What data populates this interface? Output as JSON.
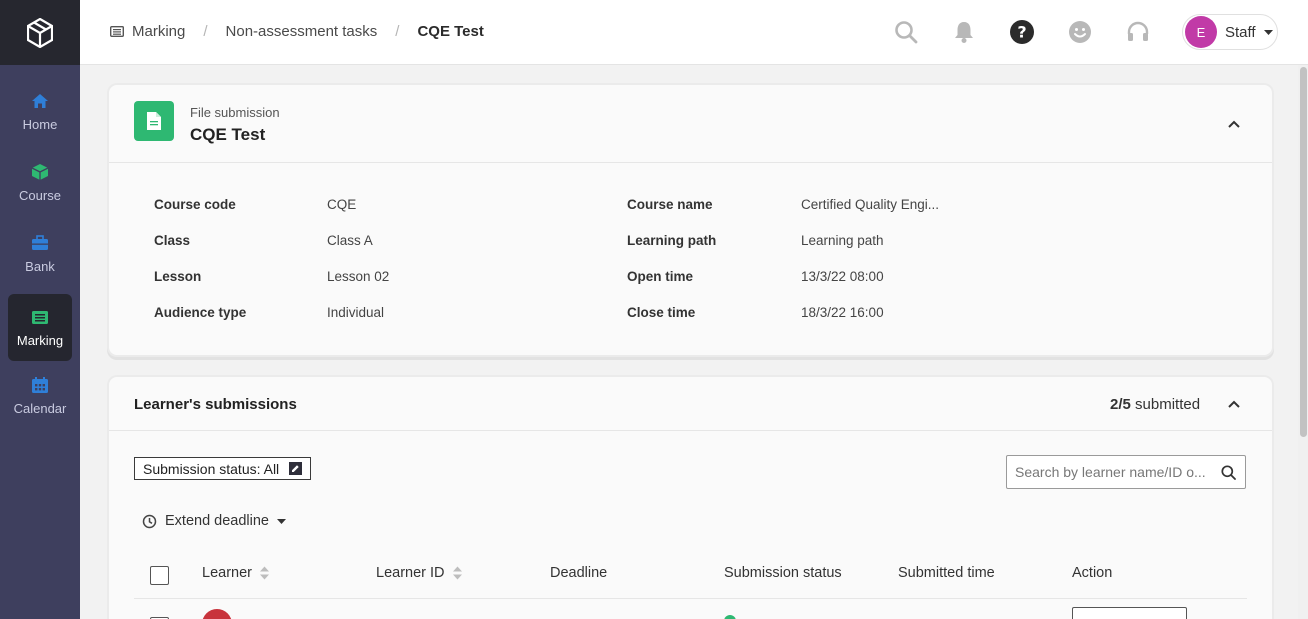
{
  "sidebar": {
    "items": [
      {
        "label": "Home",
        "icon": "home-icon",
        "color": "#2f7fd8"
      },
      {
        "label": "Course",
        "icon": "cube-icon",
        "color": "#2eb872"
      },
      {
        "label": "Bank",
        "icon": "briefcase-icon",
        "color": "#2f7fd8"
      },
      {
        "label": "Marking",
        "icon": "marking-icon",
        "color": "#2eb872",
        "active": true
      },
      {
        "label": "Calendar",
        "icon": "calendar-icon",
        "color": "#2f7fd8"
      }
    ]
  },
  "header": {
    "breadcrumb": [
      "Marking",
      "Non-assessment tasks",
      "CQE Test"
    ],
    "user": {
      "initial": "E",
      "name": "Staff"
    }
  },
  "task": {
    "type": "File submission",
    "title": "CQE Test",
    "details_left": [
      {
        "label": "Course code",
        "value": "CQE"
      },
      {
        "label": "Class",
        "value": "Class A"
      },
      {
        "label": "Lesson",
        "value": "Lesson 02"
      },
      {
        "label": "Audience type",
        "value": "Individual"
      }
    ],
    "details_right": [
      {
        "label": "Course name",
        "value": "Certified Quality Engi..."
      },
      {
        "label": "Learning path",
        "value": "Learning path"
      },
      {
        "label": "Open time",
        "value": "13/3/22 08:00"
      },
      {
        "label": "Close time",
        "value": "18/3/22 16:00"
      }
    ]
  },
  "submissions": {
    "title": "Learner's submissions",
    "count": "2/5",
    "count_suffix": "submitted",
    "filter_label": "Submission status: All",
    "search_placeholder": "Search by learner name/ID o...",
    "extend_label": "Extend deadline",
    "columns": [
      "Learner",
      "Learner ID",
      "Deadline",
      "Submission status",
      "Submitted time",
      "Action"
    ]
  },
  "colors": {
    "accent_green": "#2eb872",
    "accent_blue": "#2f7fd8",
    "avatar": "#c13aa7"
  }
}
